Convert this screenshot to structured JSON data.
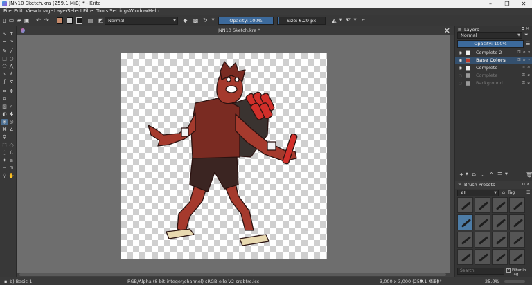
{
  "window": {
    "title": "JNN10 Sketch.kra (259.1 MiB)  * - Krita",
    "minimize": "–",
    "maximize": "❐",
    "close": "✕"
  },
  "menu": [
    "File",
    "Edit",
    "View",
    "Image",
    "Layer",
    "Select",
    "Filter",
    "Tools",
    "Settings",
    "Window",
    "Help"
  ],
  "tool_options": {
    "blend_mode": "Normal",
    "opacity_label": "Opacity: 100%",
    "opacity_value": 100,
    "size_label": "Size: 6.29 px",
    "size_fraction": 0.03,
    "colors": {
      "foreground": "#1a1a1a",
      "background": "#c9c9c9",
      "pattern": "#c68a6a"
    }
  },
  "document": {
    "tab_title": "JNN10 Sketch.kra *",
    "close": "✕"
  },
  "layers_docker": {
    "title": "Layers",
    "blend_mode": "Normal",
    "opacity_label": "Opacity:  100%",
    "layers": [
      {
        "name": "Complete 2",
        "selected": false,
        "visible": true,
        "props": "⚿ ⌀ ▾"
      },
      {
        "name": "Base Colors",
        "selected": true,
        "visible": true,
        "props": "⚿ ⌀ ▾"
      },
      {
        "name": "Complete",
        "selected": false,
        "visible": true,
        "props": "⚿ ⌀"
      },
      {
        "name": "Complete",
        "selected": false,
        "visible": false,
        "props": "⚿ ⌀"
      },
      {
        "name": "Background",
        "selected": false,
        "visible": false,
        "props": "⚿ ⌀"
      }
    ]
  },
  "brush_presets": {
    "title": "Brush Presets",
    "filter": "All",
    "tag": "Tag",
    "search_placeholder": "Search",
    "filter_in_tag": "Filter in Tag",
    "selected_index": 4
  },
  "status": {
    "brush": "b) Basic-1",
    "color_info": "RGB/Alpha (8-bit integer/channel)  sRGB-elle-V2-srgbtrc.icc",
    "dimensions": "3,000 x 3,000 (259.1 MiB)",
    "rotation": "0.00°",
    "zoom": "25.0%"
  }
}
